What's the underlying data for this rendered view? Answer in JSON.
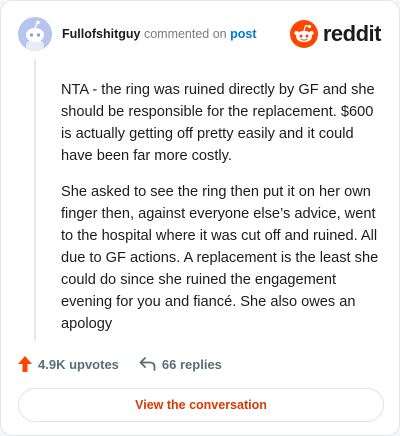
{
  "header": {
    "username": "Fullofshitguy",
    "action_text": "commented on",
    "post_link": "post",
    "brand_wordmark": "reddit"
  },
  "comment": {
    "paragraphs": [
      "NTA - the ring was ruined directly by GF and she should be responsible for the replacement. $600 is actually getting off pretty easily and it could have been far more costly.",
      "She asked to see the ring then put it on her own finger then, against everyone else’s advice, went to the hospital where it was cut off and ruined. All due to GF actions. A replacement is the least she could do since she ruined the engagement evening for you and fiancé. She also owes an apology"
    ]
  },
  "actions": {
    "upvotes": "4.9K upvotes",
    "replies": "66 replies"
  },
  "cta": {
    "label": "View the conversation"
  },
  "colors": {
    "brand": "#ff4500",
    "upvote": "#ff4500",
    "link": "#0079d3",
    "cta_text": "#d93a00",
    "avatar_bg": "#b7c5ee"
  },
  "icons": {
    "avatar": "snoo-avatar-icon",
    "logo": "reddit-snoo-icon",
    "upvote": "upvote-arrow-icon",
    "reply": "reply-arrow-icon"
  }
}
